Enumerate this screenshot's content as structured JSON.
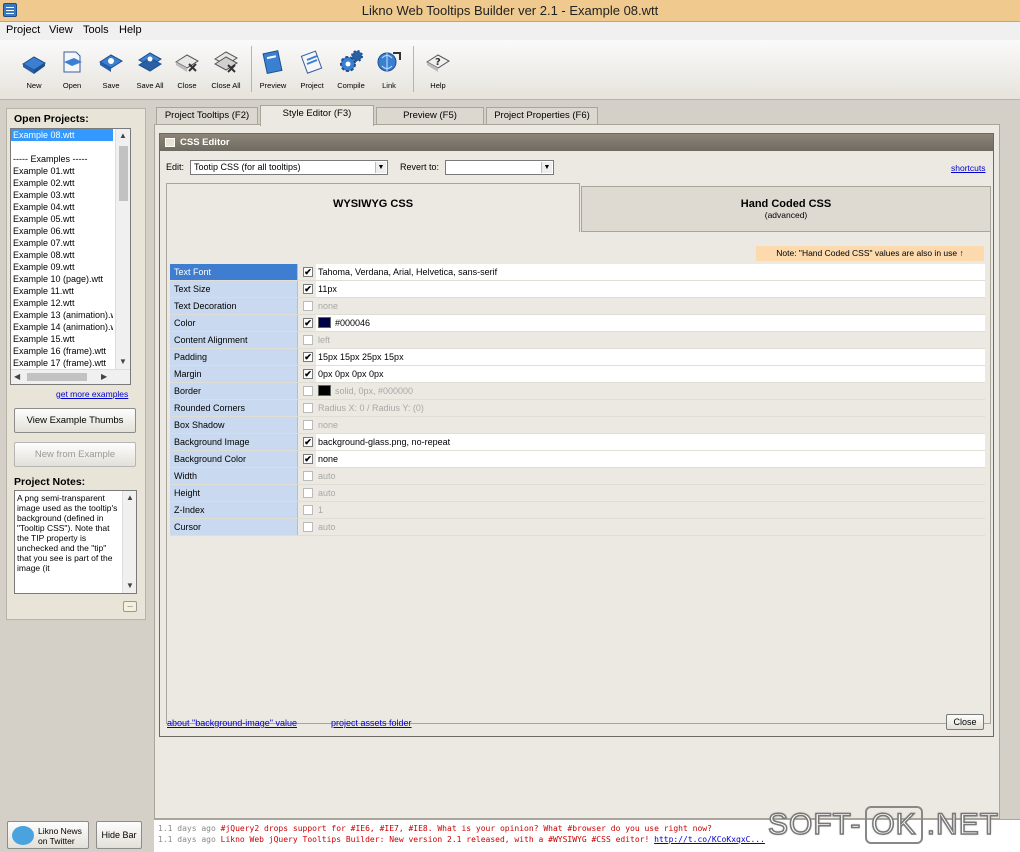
{
  "window": {
    "title": "Likno Web Tooltips Builder ver 2.1 - Example 08.wtt"
  },
  "menu": [
    "Project",
    "View",
    "Tools",
    "Help"
  ],
  "toolbar": {
    "buttons": [
      {
        "label": "New",
        "icon": "new-project-icon"
      },
      {
        "label": "Open",
        "icon": "open-project-icon"
      },
      {
        "label": "Save",
        "icon": "save-icon"
      },
      {
        "label": "Save All",
        "icon": "save-all-icon"
      },
      {
        "label": "Close",
        "icon": "close-project-icon"
      },
      {
        "label": "Close All",
        "icon": "close-all-icon"
      },
      {
        "label": "Preview",
        "icon": "preview-icon"
      },
      {
        "label": "Project",
        "icon": "project-icon"
      },
      {
        "label": "Compile",
        "icon": "compile-icon"
      },
      {
        "label": "Link",
        "icon": "link-icon"
      },
      {
        "label": "Help",
        "icon": "help-icon"
      }
    ]
  },
  "sidebar": {
    "open_projects_title": "Open Projects:",
    "projects": [
      "Example 08.wtt",
      "",
      "----- Examples -----",
      "Example 01.wtt",
      "Example 02.wtt",
      "Example 03.wtt",
      "Example 04.wtt",
      "Example 05.wtt",
      "Example 06.wtt",
      "Example 07.wtt",
      "Example 08.wtt",
      "Example 09.wtt",
      "Example 10 (page).wtt",
      "Example 11.wtt",
      "Example 12.wtt",
      "Example 13 (animation).w",
      "Example 14 (animation).w",
      "Example 15.wtt",
      "Example 16 (frame).wtt",
      "Example 17 (frame).wtt"
    ],
    "get_more_link": "get more examples",
    "view_thumbs_button": "View Example Thumbs",
    "new_from_example_button": "New from Example",
    "notes_title": "Project Notes:",
    "notes_text": "A png semi-transparent image used as the tooltip's background (defined in \"Tooltip CSS\"). Note that the TIP property is unchecked and the \"tip\" that you see is part of the image (it",
    "notes_more": "..."
  },
  "tabs": [
    {
      "label": "Project Tooltips  (F2)"
    },
    {
      "label": "Style Editor  (F3)"
    },
    {
      "label": "Preview  (F5)"
    },
    {
      "label": "Project Properties  (F6)"
    }
  ],
  "css_editor": {
    "title": "CSS Editor",
    "edit_label": "Edit:",
    "edit_value": "Tootip CSS (for all tooltips)",
    "revert_label": "Revert to:",
    "revert_value": "",
    "shortcuts_link": "shortcuts",
    "mode_wysiwyg": "WYSIWYG CSS",
    "mode_hand": "Hand Coded CSS",
    "mode_hand_sub": "(advanced)",
    "note": "Note: \"Hand Coded CSS\" values are also in use",
    "note_arrow": "↑",
    "properties": [
      {
        "name": "Text Font",
        "checked": true,
        "value": "Tahoma, Verdana, Arial, Helvetica, sans-serif",
        "swatch": ""
      },
      {
        "name": "Text Size",
        "checked": true,
        "value": "11px",
        "swatch": ""
      },
      {
        "name": "Text Decoration",
        "checked": false,
        "value": "none",
        "swatch": ""
      },
      {
        "name": "Color",
        "checked": true,
        "value": "#000046",
        "swatch": "#000046"
      },
      {
        "name": "Content Alignment",
        "checked": false,
        "value": "left",
        "swatch": ""
      },
      {
        "name": "Padding",
        "checked": true,
        "value": "15px 15px 25px 15px",
        "swatch": ""
      },
      {
        "name": "Margin",
        "checked": true,
        "value": "0px 0px 0px 0px",
        "swatch": ""
      },
      {
        "name": "Border",
        "checked": false,
        "value": "solid, 0px, #000000",
        "swatch": "#000000"
      },
      {
        "name": "Rounded Corners",
        "checked": false,
        "value": "Radius X: 0  /  Radius Y: (0)",
        "swatch": ""
      },
      {
        "name": "Box Shadow",
        "checked": false,
        "value": "none",
        "swatch": ""
      },
      {
        "name": "Background Image",
        "checked": true,
        "value": "background-glass.png, no-repeat",
        "swatch": ""
      },
      {
        "name": "Background Color",
        "checked": true,
        "value": "none",
        "swatch": ""
      },
      {
        "name": "Width",
        "checked": false,
        "value": "auto",
        "swatch": ""
      },
      {
        "name": "Height",
        "checked": false,
        "value": "auto",
        "swatch": ""
      },
      {
        "name": "Z-Index",
        "checked": false,
        "value": "1",
        "swatch": ""
      },
      {
        "name": "Cursor",
        "checked": false,
        "value": "auto",
        "swatch": ""
      }
    ],
    "about_link": "about \"background-image\" value",
    "assets_link": "project assets folder",
    "close_button": "Close"
  },
  "footer": {
    "twitter_button": "Likno News on Twitter",
    "hide_bar_button": "Hide Bar",
    "news": [
      {
        "age": "1.1 days ago",
        "text": "#jQuery2 drops support for #IE6, #IE7, #IE8. What is your opinion? What #browser do you use right now?",
        "link": ""
      },
      {
        "age": "1.1 days ago",
        "text": "Likno Web jQuery Tooltips Builder: New version 2.1 released, with a #WYSIWYG #CSS editor!",
        "link": "http://t.co/KCoKxqxC..."
      }
    ]
  },
  "watermark": {
    "left": "SOFT-",
    "box": "OK",
    "right": ".NET"
  }
}
